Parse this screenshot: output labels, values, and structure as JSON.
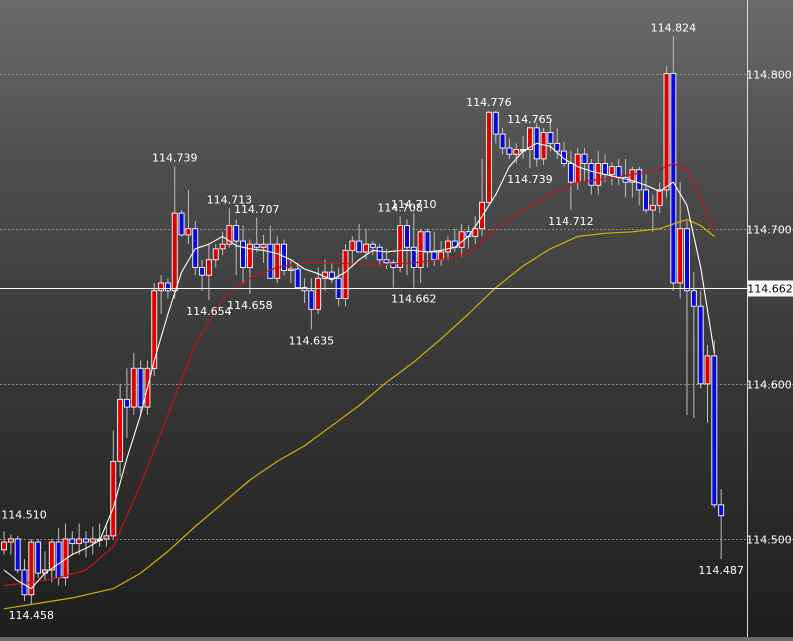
{
  "chart_data": {
    "type": "candlestick",
    "title": "",
    "xlabel": "",
    "ylabel": "",
    "ylim": [
      114.4368,
      114.8474
    ],
    "y_ticks": [
      {
        "value": 114.8,
        "label": "114.800"
      },
      {
        "value": 114.7,
        "label": "114.700"
      },
      {
        "value": 114.6,
        "label": "114.600"
      },
      {
        "value": 114.5,
        "label": "114.500"
      }
    ],
    "current_price": {
      "value": 114.662,
      "label": "114.662"
    },
    "colors": {
      "up": "#dd0000",
      "down": "#0a0ad8",
      "doji": "#d4cf2a",
      "wick": "#bdbdbd",
      "grid": "#a8a8a8",
      "ma_fast": "#ffffff",
      "ma_mid": "#c41414",
      "ma_slow": "#d4b000",
      "price_line": "#ffffff",
      "text": "#ffffff"
    },
    "candles": [
      [
        114.493,
        114.505,
        114.49,
        114.498
      ],
      [
        114.498,
        114.503,
        114.49,
        114.5
      ],
      [
        114.5,
        114.502,
        114.478,
        114.48
      ],
      [
        114.48,
        114.487,
        114.46,
        114.464
      ],
      [
        114.464,
        114.5,
        114.458,
        114.498
      ],
      [
        114.498,
        114.5,
        114.475,
        114.478
      ],
      [
        114.478,
        114.492,
        114.473,
        114.48
      ],
      [
        114.48,
        114.5,
        114.472,
        114.498
      ],
      [
        114.498,
        114.507,
        114.47,
        114.475
      ],
      [
        114.475,
        114.51,
        114.47,
        114.5
      ],
      [
        114.5,
        114.505,
        114.49,
        114.497
      ],
      [
        114.497,
        114.51,
        114.49,
        114.5
      ],
      [
        114.5,
        114.505,
        114.488,
        114.498
      ],
      [
        114.498,
        114.508,
        114.49,
        114.5
      ],
      [
        114.5,
        114.51,
        114.495,
        114.5
      ],
      [
        114.5,
        114.508,
        114.495,
        114.502
      ],
      [
        114.502,
        114.57,
        114.5,
        114.55
      ],
      [
        114.55,
        114.6,
        114.54,
        114.59
      ],
      [
        114.59,
        114.61,
        114.565,
        114.585
      ],
      [
        114.585,
        114.62,
        114.58,
        114.61
      ],
      [
        114.61,
        114.615,
        114.58,
        114.585
      ],
      [
        114.585,
        114.615,
        114.58,
        114.61
      ],
      [
        114.61,
        114.665,
        114.605,
        114.66
      ],
      [
        114.66,
        114.67,
        114.645,
        114.665
      ],
      [
        114.665,
        114.668,
        114.655,
        114.66
      ],
      [
        114.66,
        114.74,
        114.655,
        114.71
      ],
      [
        114.71,
        114.712,
        114.695,
        114.696
      ],
      [
        114.696,
        114.725,
        114.69,
        114.7
      ],
      [
        114.7,
        114.705,
        114.67,
        114.675
      ],
      [
        114.675,
        114.68,
        114.66,
        114.67
      ],
      [
        114.67,
        114.69,
        114.654,
        114.68
      ],
      [
        114.68,
        114.69,
        114.675,
        114.687
      ],
      [
        114.687,
        114.698,
        114.683,
        114.69
      ],
      [
        114.69,
        114.713,
        114.688,
        114.702
      ],
      [
        114.702,
        114.706,
        114.67,
        114.692
      ],
      [
        114.692,
        114.702,
        114.665,
        114.675
      ],
      [
        114.675,
        114.693,
        114.658,
        114.69
      ],
      [
        114.69,
        114.707,
        114.685,
        114.688
      ],
      [
        114.688,
        114.696,
        114.678,
        114.69
      ],
      [
        114.69,
        114.702,
        114.68,
        114.668
      ],
      [
        114.668,
        114.695,
        114.665,
        114.69
      ],
      [
        114.69,
        114.693,
        114.67,
        114.673
      ],
      [
        114.673,
        114.68,
        114.665,
        114.674
      ],
      [
        114.674,
        114.678,
        114.665,
        114.662
      ],
      [
        114.662,
        114.668,
        114.652,
        114.66
      ],
      [
        114.66,
        114.668,
        114.635,
        114.648
      ],
      [
        114.648,
        114.675,
        114.645,
        114.668
      ],
      [
        114.668,
        114.68,
        114.66,
        114.672
      ],
      [
        114.672,
        114.678,
        114.665,
        114.668
      ],
      [
        114.668,
        114.675,
        114.65,
        114.655
      ],
      [
        114.655,
        114.69,
        114.65,
        114.686
      ],
      [
        114.686,
        114.695,
        114.676,
        114.692
      ],
      [
        114.692,
        114.703,
        114.688,
        114.685
      ],
      [
        114.685,
        114.7,
        114.68,
        114.69
      ],
      [
        114.69,
        114.692,
        114.683,
        114.688
      ],
      [
        114.688,
        114.69,
        114.676,
        114.68
      ],
      [
        114.68,
        114.687,
        114.674,
        114.678
      ],
      [
        114.678,
        114.68,
        114.662,
        114.675
      ],
      [
        114.675,
        114.708,
        114.672,
        114.702
      ],
      [
        114.702,
        114.706,
        114.67,
        114.688
      ],
      [
        114.688,
        114.71,
        114.662,
        114.675
      ],
      [
        114.675,
        114.7,
        114.665,
        114.698
      ],
      [
        114.698,
        114.7,
        114.675,
        114.685
      ],
      [
        114.685,
        114.698,
        114.676,
        114.68
      ],
      [
        114.68,
        114.692,
        114.676,
        114.685
      ],
      [
        114.685,
        114.695,
        114.68,
        114.692
      ],
      [
        114.692,
        114.7,
        114.685,
        114.688
      ],
      [
        114.688,
        114.703,
        114.682,
        114.698
      ],
      [
        114.698,
        114.702,
        114.687,
        114.695
      ],
      [
        114.695,
        114.708,
        114.69,
        114.7
      ],
      [
        114.7,
        114.745,
        114.695,
        114.717
      ],
      [
        114.717,
        114.776,
        114.715,
        114.775
      ],
      [
        114.775,
        114.776,
        114.755,
        114.761
      ],
      [
        114.761,
        114.765,
        114.748,
        114.752
      ],
      [
        114.752,
        114.758,
        114.745,
        114.748
      ],
      [
        114.748,
        114.755,
        114.742,
        114.751
      ],
      [
        114.751,
        114.76,
        114.745,
        114.751
      ],
      [
        114.751,
        114.764,
        114.739,
        114.765
      ],
      [
        114.765,
        114.768,
        114.74,
        114.745
      ],
      [
        114.745,
        114.765,
        114.741,
        114.762
      ],
      [
        114.762,
        114.77,
        114.75,
        114.755
      ],
      [
        114.755,
        114.765,
        114.745,
        114.75
      ],
      [
        114.75,
        114.756,
        114.74,
        114.742
      ],
      [
        114.742,
        114.75,
        114.712,
        114.73
      ],
      [
        114.73,
        114.752,
        114.725,
        114.748
      ],
      [
        114.748,
        114.752,
        114.73,
        114.742
      ],
      [
        114.742,
        114.745,
        114.722,
        114.728
      ],
      [
        114.728,
        114.75,
        114.722,
        114.742
      ],
      [
        114.742,
        114.748,
        114.73,
        114.735
      ],
      [
        114.735,
        114.743,
        114.728,
        114.74
      ],
      [
        114.74,
        114.745,
        114.728,
        114.733
      ],
      [
        114.733,
        114.745,
        114.72,
        114.73
      ],
      [
        114.73,
        114.74,
        114.72,
        114.738
      ],
      [
        114.738,
        114.74,
        114.715,
        114.725
      ],
      [
        114.725,
        114.735,
        114.71,
        114.712
      ],
      [
        114.712,
        114.722,
        114.698,
        114.715
      ],
      [
        114.715,
        114.73,
        114.71,
        114.725
      ],
      [
        114.725,
        114.805,
        114.72,
        114.8
      ],
      [
        114.8,
        114.824,
        114.66,
        114.665
      ],
      [
        114.665,
        114.73,
        114.655,
        114.7
      ],
      [
        114.7,
        114.705,
        114.58,
        114.66
      ],
      [
        114.66,
        114.672,
        114.578,
        114.65
      ],
      [
        114.65,
        114.66,
        114.597,
        114.6
      ],
      [
        114.6,
        114.625,
        114.575,
        114.618
      ],
      [
        114.618,
        114.628,
        114.52,
        114.522
      ],
      [
        114.522,
        114.532,
        114.487,
        114.515
      ]
    ],
    "ma_fast": [
      [
        0,
        114.48
      ],
      [
        2,
        114.473
      ],
      [
        4,
        114.468
      ],
      [
        6,
        114.478
      ],
      [
        8,
        114.484
      ],
      [
        10,
        114.49
      ],
      [
        12,
        114.494
      ],
      [
        14,
        114.499
      ],
      [
        16,
        114.52
      ],
      [
        18,
        114.552
      ],
      [
        20,
        114.58
      ],
      [
        22,
        114.615
      ],
      [
        24,
        114.645
      ],
      [
        26,
        114.672
      ],
      [
        28,
        114.687
      ],
      [
        30,
        114.69
      ],
      [
        32,
        114.695
      ],
      [
        34,
        114.689
      ],
      [
        36,
        114.687
      ],
      [
        38,
        114.686
      ],
      [
        40,
        114.684
      ],
      [
        42,
        114.68
      ],
      [
        44,
        114.674
      ],
      [
        46,
        114.671
      ],
      [
        48,
        114.667
      ],
      [
        50,
        114.672
      ],
      [
        52,
        114.68
      ],
      [
        54,
        114.686
      ],
      [
        56,
        114.685
      ],
      [
        58,
        114.686
      ],
      [
        60,
        114.686
      ],
      [
        62,
        114.685
      ],
      [
        64,
        114.686
      ],
      [
        66,
        114.688
      ],
      [
        68,
        114.695
      ],
      [
        70,
        114.708
      ],
      [
        72,
        114.722
      ],
      [
        74,
        114.74
      ],
      [
        76,
        114.75
      ],
      [
        78,
        114.755
      ],
      [
        80,
        114.753
      ],
      [
        82,
        114.745
      ],
      [
        84,
        114.74
      ],
      [
        86,
        114.737
      ],
      [
        88,
        114.735
      ],
      [
        90,
        114.733
      ],
      [
        92,
        114.731
      ],
      [
        94,
        114.728
      ],
      [
        96,
        114.724
      ],
      [
        98,
        114.73
      ],
      [
        100,
        114.715
      ],
      [
        102,
        114.675
      ],
      [
        104,
        114.62
      ]
    ],
    "ma_mid": [
      [
        0,
        114.47
      ],
      [
        4,
        114.472
      ],
      [
        8,
        114.475
      ],
      [
        12,
        114.48
      ],
      [
        16,
        114.495
      ],
      [
        20,
        114.535
      ],
      [
        24,
        114.58
      ],
      [
        28,
        114.625
      ],
      [
        32,
        114.655
      ],
      [
        36,
        114.668
      ],
      [
        40,
        114.675
      ],
      [
        44,
        114.678
      ],
      [
        48,
        114.678
      ],
      [
        52,
        114.677
      ],
      [
        56,
        114.677
      ],
      [
        60,
        114.678
      ],
      [
        64,
        114.68
      ],
      [
        68,
        114.684
      ],
      [
        72,
        114.7
      ],
      [
        76,
        114.712
      ],
      [
        80,
        114.722
      ],
      [
        84,
        114.73
      ],
      [
        88,
        114.732
      ],
      [
        92,
        114.735
      ],
      [
        96,
        114.738
      ],
      [
        98,
        114.742
      ],
      [
        100,
        114.738
      ],
      [
        102,
        114.72
      ],
      [
        104,
        114.698
      ]
    ],
    "ma_slow": [
      [
        0,
        114.455
      ],
      [
        10,
        114.462
      ],
      [
        16,
        114.468
      ],
      [
        20,
        114.478
      ],
      [
        24,
        114.492
      ],
      [
        28,
        114.508
      ],
      [
        32,
        114.523
      ],
      [
        36,
        114.538
      ],
      [
        40,
        114.55
      ],
      [
        44,
        114.56
      ],
      [
        48,
        114.573
      ],
      [
        52,
        114.586
      ],
      [
        56,
        114.601
      ],
      [
        60,
        114.614
      ],
      [
        64,
        114.629
      ],
      [
        68,
        114.645
      ],
      [
        72,
        114.662
      ],
      [
        76,
        114.676
      ],
      [
        80,
        114.687
      ],
      [
        84,
        114.695
      ],
      [
        88,
        114.697
      ],
      [
        92,
        114.698
      ],
      [
        96,
        114.7
      ],
      [
        98,
        114.703
      ],
      [
        100,
        114.706
      ],
      [
        102,
        114.702
      ],
      [
        104,
        114.695
      ]
    ],
    "annotations": [
      {
        "label": "114.510",
        "value": 114.51,
        "idx": 0,
        "pos": "above"
      },
      {
        "label": "114.458",
        "value": 114.458,
        "idx": 4,
        "pos": "below"
      },
      {
        "label": "114.739",
        "value": 114.74,
        "idx": 25,
        "pos": "above"
      },
      {
        "label": "114.654",
        "value": 114.654,
        "idx": 30,
        "pos": "below"
      },
      {
        "label": "114.713",
        "value": 114.713,
        "idx": 33,
        "pos": "above"
      },
      {
        "label": "114.658",
        "value": 114.658,
        "idx": 36,
        "pos": "below"
      },
      {
        "label": "114.707",
        "value": 114.707,
        "idx": 37,
        "pos": "above"
      },
      {
        "label": "114.635",
        "value": 114.635,
        "idx": 45,
        "pos": "below"
      },
      {
        "label": "114.708",
        "value": 114.708,
        "idx": 58,
        "pos": "above"
      },
      {
        "label": "114.710",
        "value": 114.71,
        "idx": 60,
        "pos": "above"
      },
      {
        "label": "114.662",
        "value": 114.662,
        "idx": 60,
        "pos": "below"
      },
      {
        "label": "114.776",
        "value": 114.776,
        "idx": 71,
        "pos": "above"
      },
      {
        "label": "114.765",
        "value": 114.765,
        "idx": 77,
        "pos": "above"
      },
      {
        "label": "114.739",
        "value": 114.739,
        "idx": 77,
        "pos": "below"
      },
      {
        "label": "114.712",
        "value": 114.712,
        "idx": 83,
        "pos": "below"
      },
      {
        "label": "114.824",
        "value": 114.824,
        "idx": 98,
        "pos": "above"
      },
      {
        "label": "114.487",
        "value": 114.487,
        "idx": 105,
        "pos": "below"
      }
    ]
  }
}
